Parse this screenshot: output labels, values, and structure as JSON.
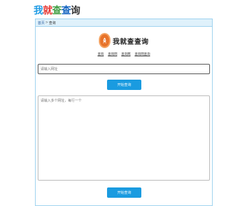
{
  "site": {
    "logo_chars": [
      {
        "text": "我",
        "color": "#1e9be5"
      },
      {
        "text": "就",
        "color": "#e53935"
      },
      {
        "text": "查",
        "color": "#43a047"
      },
      {
        "text": "查",
        "color": "#1565c0"
      },
      {
        "text": "询",
        "color": "#333333"
      }
    ]
  },
  "breadcrumb": {
    "home": "首页",
    "separator": ">",
    "current": "查询"
  },
  "brand": {
    "name": "我就查查询",
    "icon": "rocket-icon",
    "accent": "#e8732a"
  },
  "links": [
    "查询",
    "查询网",
    "查询网",
    "查询网查询"
  ],
  "url_input": {
    "value": "",
    "placeholder": "请输入网址"
  },
  "top_button": {
    "label": "开始查询"
  },
  "textarea": {
    "value": "",
    "placeholder": "请输入多个网址，每行一个"
  },
  "bottom_button": {
    "label": "开始查询"
  }
}
